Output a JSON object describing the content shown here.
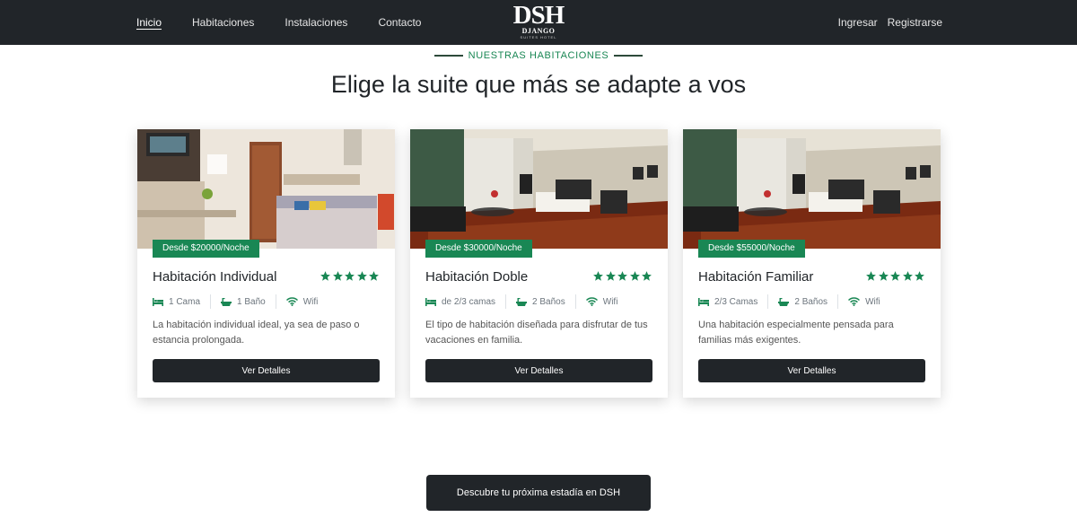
{
  "nav": {
    "left_links": [
      "Inicio",
      "Habitaciones",
      "Instalaciones",
      "Contacto"
    ],
    "right_links": [
      "Ingresar",
      "Registrarse"
    ],
    "logo": {
      "main": "DSH",
      "sub": "DJANGO",
      "tag": "SUITES HOTEL"
    }
  },
  "section": {
    "eyebrow": "NUESTRAS HABITACIONES",
    "headline": "Elige la suite que más se adapte a vos"
  },
  "cards": [
    {
      "price": "Desde $20000/Noche",
      "title": "Habitación Individual",
      "rating": 5,
      "beds": "1 Cama",
      "baths": "1 Baño",
      "wifi": "Wifi",
      "description": "La habitación individual ideal, ya sea de paso o estancia prolongada.",
      "button": "Ver Detalles"
    },
    {
      "price": "Desde $30000/Noche",
      "title": "Habitación Doble",
      "rating": 5,
      "beds": "de 2/3 camas",
      "baths": "2 Baños",
      "wifi": "Wifi",
      "description": "El tipo de habitación diseñada para disfrutar de tus vacaciones en familia.",
      "button": "Ver Detalles"
    },
    {
      "price": "Desde $55000/Noche",
      "title": "Habitación Familiar",
      "rating": 5,
      "beds": "2/3 Camas",
      "baths": "2 Baños",
      "wifi": "Wifi",
      "description": "Una habitación especialmente pensada para familias más exigentes.",
      "button": "Ver Detalles"
    }
  ],
  "cta": {
    "label": "Descubre tu próxima estadía en DSH"
  },
  "colors": {
    "navbar": "#212529",
    "accent": "#198754",
    "button": "#212529"
  },
  "icons": [
    "bed-icon",
    "bathtub-icon",
    "wifi-icon",
    "star-icon"
  ]
}
